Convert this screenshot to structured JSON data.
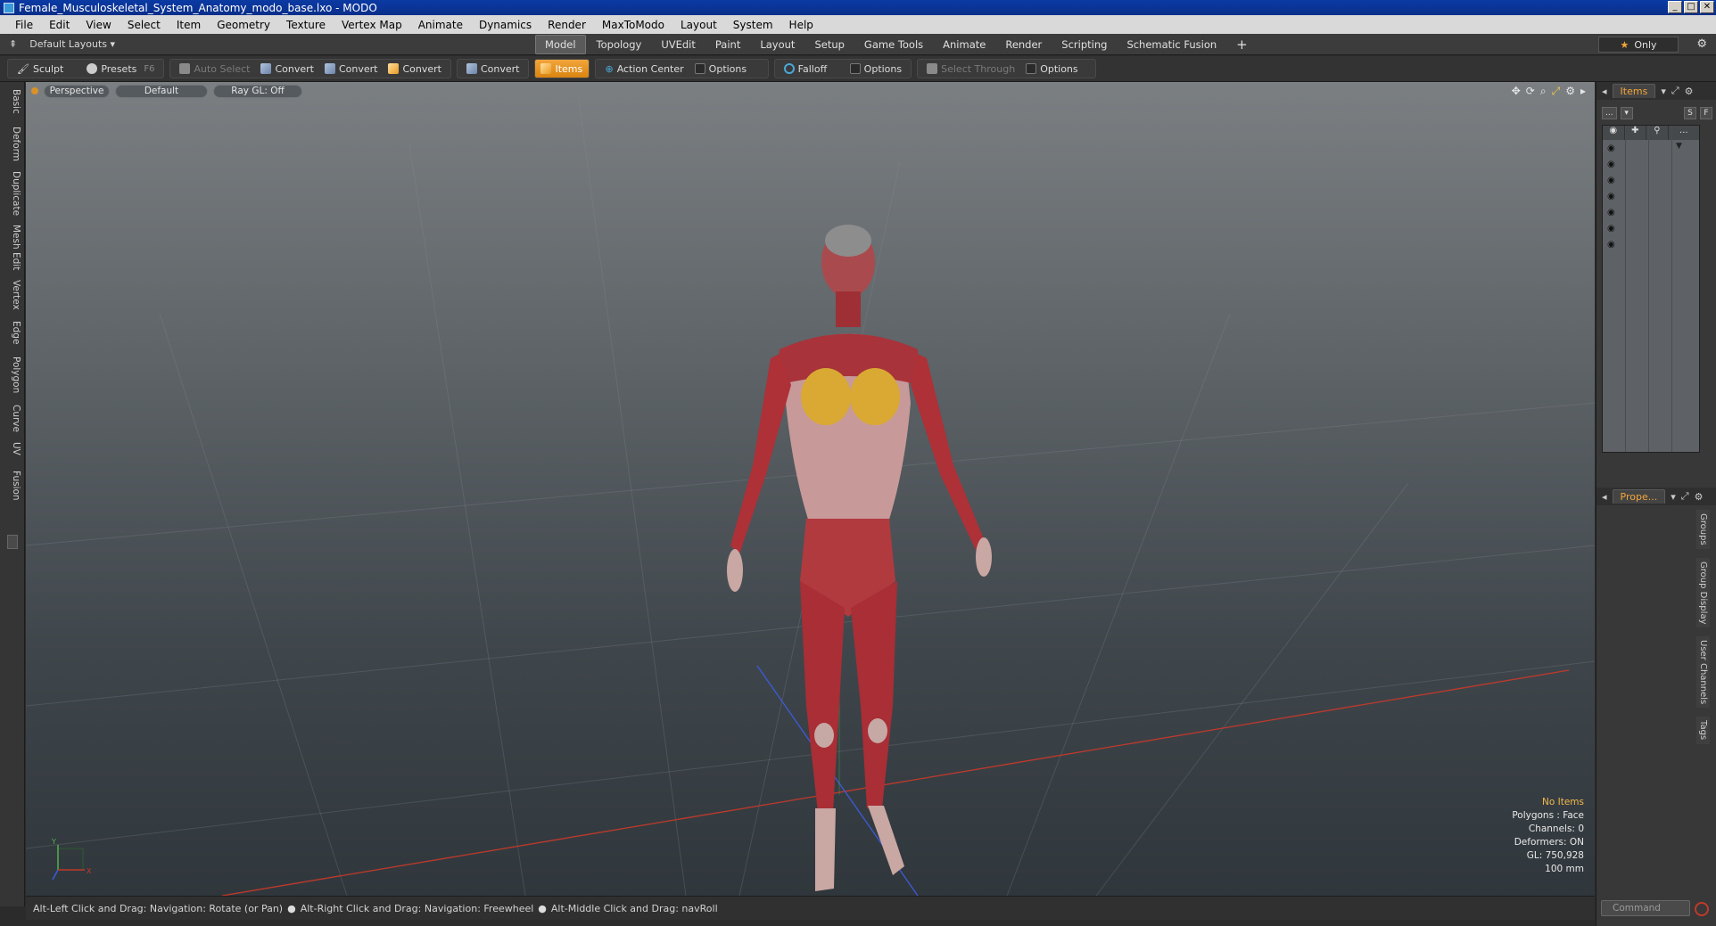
{
  "window": {
    "title": "Female_Musculoskeletal_System_Anatomy_modo_base.lxo - MODO",
    "buttons": [
      "_",
      "□",
      "✕"
    ]
  },
  "menu": [
    "File",
    "Edit",
    "View",
    "Select",
    "Item",
    "Geometry",
    "Texture",
    "Vertex Map",
    "Animate",
    "Dynamics",
    "Render",
    "MaxToModo",
    "Layout",
    "System",
    "Help"
  ],
  "layoutbar": {
    "default_layouts": "Default Layouts",
    "tabs": [
      "Model",
      "Topology",
      "UVEdit",
      "Paint",
      "Layout",
      "Setup",
      "Game Tools",
      "Animate",
      "Render",
      "Scripting",
      "Schematic Fusion"
    ],
    "active_tab": "Model",
    "add": "+",
    "only": "Only"
  },
  "toolbar": {
    "sculpt": "Sculpt",
    "presets": "Presets",
    "presets_key": "F6",
    "auto_select": "Auto Select",
    "convert": "Convert",
    "items": "Items",
    "action_center": "Action Center",
    "options": "Options",
    "falloff": "Falloff",
    "select_through": "Select Through"
  },
  "left_tabs": [
    "Basic",
    "Deform",
    "Duplicate",
    "Mesh Edit",
    "Vertex",
    "Edge",
    "Polygon",
    "Curve",
    "UV",
    "Fusion"
  ],
  "viewport": {
    "view": "Perspective",
    "shading": "Default",
    "raygl": "Ray GL: Off",
    "info": {
      "no_items": "No Items",
      "polygons": "Polygons : Face",
      "channels": "Channels: 0",
      "deformers": "Deformers: ON",
      "gl": "GL: 750,928",
      "scale": "100 mm"
    },
    "axis_y": "Y",
    "axis_x": "X"
  },
  "status": {
    "hint1": "Alt-Left Click and Drag: Navigation: Rotate (or Pan)",
    "hint2": "Alt-Right Click and Drag: Navigation: Freewheel",
    "hint3": "Alt-Middle Click and Drag: navRoll"
  },
  "right_panel": {
    "items_tab": "Items",
    "props_tab": "Prope...",
    "items_btns": [
      "...",
      "S",
      "F"
    ],
    "col_more": "...",
    "prop_tabs": [
      "Groups",
      "Group Display",
      "User Channels",
      "Tags"
    ],
    "command_placeholder": "Command",
    "prompt": ">"
  },
  "colors": {
    "accent": "#f2a53b",
    "viewport_top": "#7b7f82",
    "viewport_bottom": "#30373c",
    "muscle": "#b8343a"
  }
}
